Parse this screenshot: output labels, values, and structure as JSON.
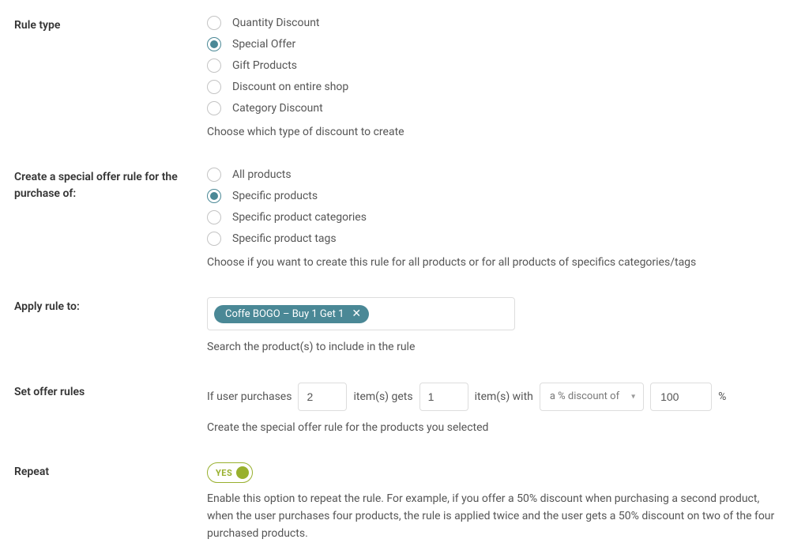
{
  "ruleType": {
    "label": "Rule type",
    "options": {
      "opt0": "Quantity Discount",
      "opt1": "Special Offer",
      "opt2": "Gift Products",
      "opt3": "Discount on entire shop",
      "opt4": "Category Discount"
    },
    "selected": "opt1",
    "helper": "Choose which type of discount to create"
  },
  "scope": {
    "label": "Create a special offer rule for the purchase of:",
    "options": {
      "s0": "All products",
      "s1": "Specific products",
      "s2": "Specific product categories",
      "s3": "Specific product tags"
    },
    "selected": "s1",
    "helper": "Choose if you want to create this rule for all products or for all products of specifics categories/tags"
  },
  "applyRule": {
    "label": "Apply rule to:",
    "tag": "Coffe BOGO – Buy 1 Get 1",
    "helper": "Search the product(s) to include in the rule"
  },
  "offerRules": {
    "label": "Set offer rules",
    "t_prefix": "If user purchases",
    "purchases": "2",
    "t_mid1": "item(s) gets",
    "gets": "1",
    "t_mid2": "item(s) with",
    "discountType": "a % discount of",
    "discountVal": "100",
    "t_suffix": "%",
    "helper": "Create the special offer rule for the products you selected"
  },
  "repeat": {
    "label": "Repeat",
    "toggleLabel": "YES",
    "helper": "Enable this option to repeat the rule. For example, if you offer a 50% discount when purchasing a second product, when the user purchases four products, the rule is applied twice and the user gets a 50% discount on two of the four purchased products."
  }
}
